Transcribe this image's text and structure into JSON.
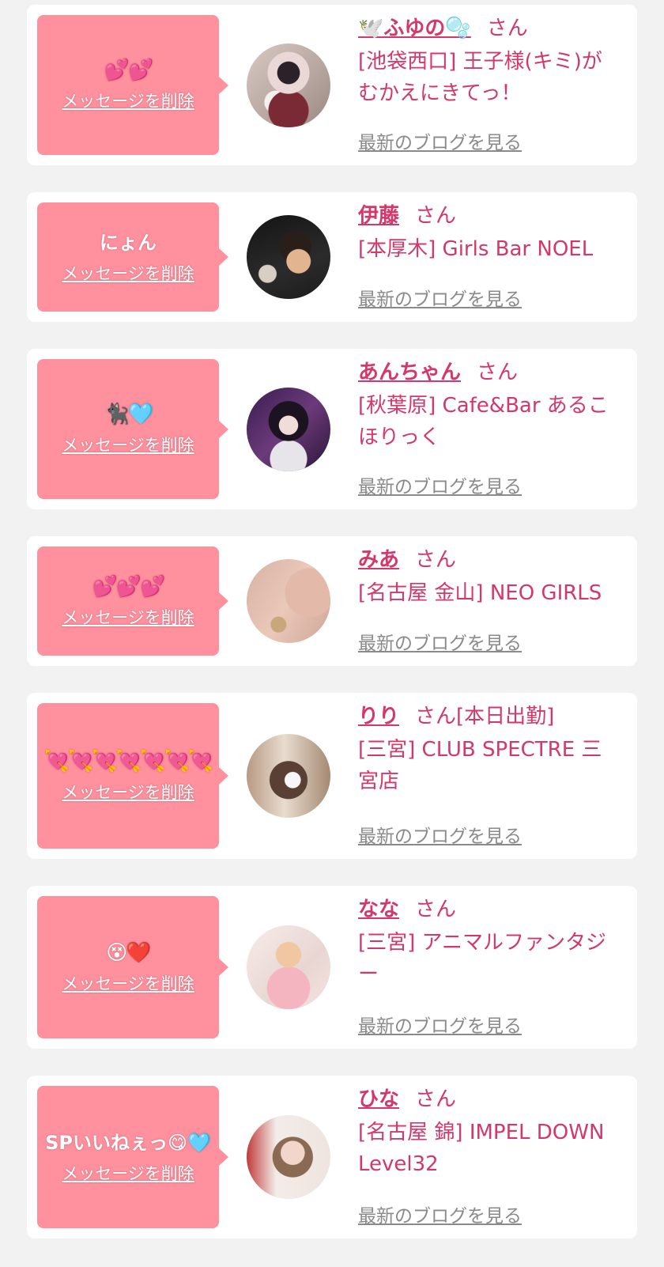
{
  "colors": {
    "page_bg": "#f2f2f2",
    "card_bg": "#ffffff",
    "message_bg": "#ff909e",
    "accent": "#d4386a",
    "link_gray": "#8a8a8a"
  },
  "delete_label": "メッセージを削除",
  "blog_label": "最新のブログを見る",
  "honorific": "さん",
  "cards": [
    {
      "message": "💕💕",
      "name": "🕊️ふゆの🫧",
      "suffix": "",
      "shop": "[池袋西口] 王子様(キミ)がむかえにきてっ！",
      "avatar_icon": "girl-photo-icon"
    },
    {
      "message": "にょん",
      "name": "伊藤",
      "suffix": "",
      "shop": "[本厚木] Girls Bar NOEL",
      "avatar_icon": "man-photo-icon"
    },
    {
      "message": "🐈‍⬛🩵",
      "name": "あんちゃん",
      "suffix": "",
      "shop": "[秋葉原] Cafe&Bar あるこほりっく",
      "avatar_icon": "girl-photo-icon"
    },
    {
      "message": "💕💕💕",
      "name": "みあ",
      "suffix": "",
      "shop": "[名古屋 金山] NEO GIRLS",
      "avatar_icon": "girl-photo-icon"
    },
    {
      "message": "💘💘💘💘💘💘💘",
      "name": "りり",
      "suffix": "[本日出勤]",
      "shop": "[三宮] CLUB SPECTRE 三宮店",
      "avatar_icon": "girl-photo-icon"
    },
    {
      "message": "😵❤️",
      "name": "なな",
      "suffix": "",
      "shop": "[三宮] アニマルファンタジー",
      "avatar_icon": "girl-photo-icon"
    },
    {
      "message": "SPいいねぇっ😋🩵",
      "name": "ひな",
      "suffix": "",
      "shop": "[名古屋 錦] IMPEL DOWN Level32",
      "avatar_icon": "girl-photo-icon"
    }
  ]
}
